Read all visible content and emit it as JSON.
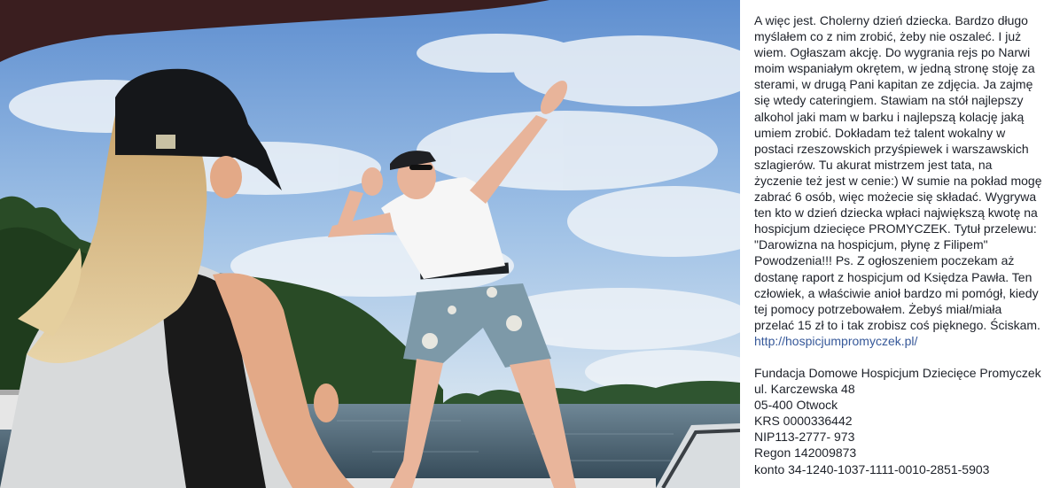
{
  "post": {
    "text": "A więc jest. Cholerny dzień dziecka. Bardzo długo myślałem co z nim zrobić, żeby nie oszaleć. I już wiem. Ogłaszam akcję. Do wygrania rejs po Narwi moim wspaniałym okrętem, w jedną stronę stoję za sterami, w drugą Pani kapitan ze zdjęcia. Ja zajmę się wtedy cateringiem. Stawiam na stół najlepszy alkohol jaki mam w barku i najlepszą kolację jaką umiem zrobić. Dokładam też talent wokalny w postaci rzeszowskich przyśpiewek i warszawskich szlagierów. Tu akurat mistrzem jest tata, na życzenie też jest w cenie:) W sumie na pokład mogę zabrać 6 osób, więc możecie się składać. Wygrywa ten kto w dzień dziecka wpłaci największą kwotę na hospicjum dziecięce PROMYCZEK. Tytuł przelewu: \"Darowizna na hospicjum, płynę z Filipem\" Powodzenia!!! Ps. Z ogłoszeniem poczekam aż dostanę raport z hospicjum od Księdza Pawła. Ten człowiek, a właściwie anioł bardzo mi pomógł, kiedy tej pomocy potrzebowałem. Żebyś miał/miała przelać 15 zł to i tak zrobisz coś pięknego. Ściskam.",
    "link": "http://hospicjumpromyczek.pl/",
    "address": [
      "Fundacja Domowe Hospicjum Dziecięce Promyczek",
      "ul. Karczewska 48",
      "05-400 Otwock",
      "KRS 0000336442",
      "NIP113-2777- 973",
      "Regon 142009873",
      "konto 34-1240-1037-1111-0010-2851-5903"
    ]
  },
  "colors": {
    "text": "#1d2129",
    "link": "#365899",
    "sky": "#7fa9d8",
    "water": "#3e5566"
  }
}
